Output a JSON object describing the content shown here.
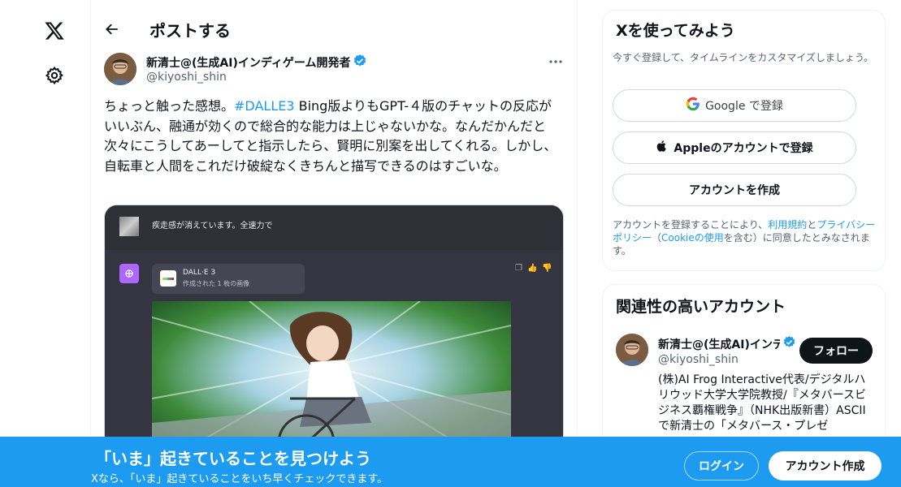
{
  "nav": {
    "logo_icon": "x-logo-icon",
    "settings_icon": "gear-icon"
  },
  "header": {
    "title": "ポストする",
    "back_icon": "arrow-left-icon"
  },
  "tweet": {
    "author_name": "新清士@(生成AI)インディゲーム開発者",
    "author_handle": "@kiyoshi_shin",
    "text_before": "ちょっと触った感想。",
    "hashtag": "#DALLE3",
    "text_after": " Bing版よりもGPT-４版のチャットの反応がいいぶん、融通が効くので総合的な能力は上じゃないかな。なんだかんだと次々にこうしてあーしてと指示したら、賢明に別案を出してくれる。しかし、自転車と人間をこれだけ破綻なくきちんと描写できるのはすごいな。",
    "media": {
      "user_message": "疾走感が消えています。全速力で",
      "dalle_title": "DALL·E 3",
      "dalle_subtitle": "作成された 1 枚の画像"
    }
  },
  "signup_card": {
    "title": "Xを使ってみよう",
    "subtitle": "今すぐ登録して、タイムラインをカスタマイズしましょう。",
    "google_label": "Google で登録",
    "apple_label": "Appleのアカウントで登録",
    "create_label": "アカウントを作成",
    "legal_before": "アカウントを登録することにより、",
    "terms_link": "利用規約",
    "legal_and": "と",
    "privacy_link": "プライバシーポリシー",
    "legal_paren_open": "（",
    "cookie_link": "Cookieの使用",
    "legal_after": "を含む）に同意したとみなされます。"
  },
  "related": {
    "title": "関連性の高いアカウント",
    "name": "新清士@(生成AI)インディゲーム開発者",
    "handle": "@kiyoshi_shin",
    "follow_label": "フォロー",
    "bio": "(株)AI Frog Interactive代表/デジタルハリウッド大学大学院教授/『メタバースビジネス覇権戦争』（NHK出版新書）ASCIIで新清士の「メタバース・プレゼ"
  },
  "bottom_bar": {
    "title": "「いま」起きていることを見つけよう",
    "subtitle": "Xなら、「いま」起きていることをいち早くチェックできます。",
    "login_label": "ログイン",
    "signup_label": "アカウント作成"
  },
  "colors": {
    "accent": "#1d9bf0",
    "text": "#0f1419",
    "secondary": "#536471",
    "border": "#eff3f4"
  }
}
